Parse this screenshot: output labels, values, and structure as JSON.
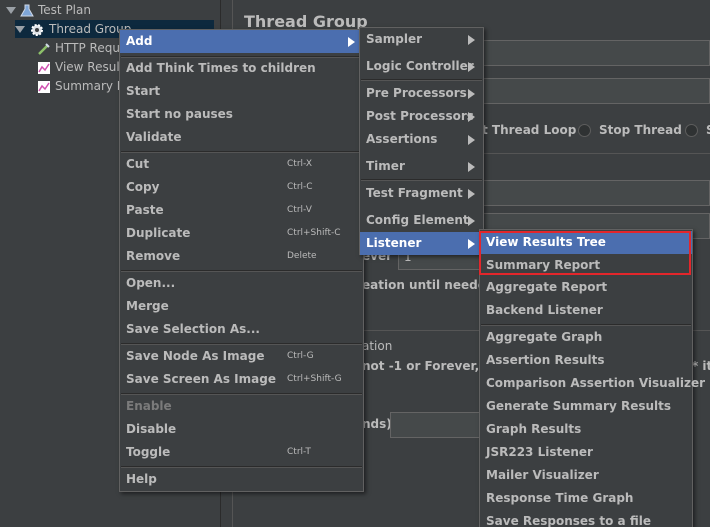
{
  "tree": {
    "items": [
      {
        "label": "Test Plan"
      },
      {
        "label": "Thread Group"
      },
      {
        "label": "HTTP Requ"
      },
      {
        "label": "View Resul"
      },
      {
        "label": "Summary R"
      }
    ]
  },
  "main": {
    "title": "Thread Group",
    "bg_texts": {
      "thread_loop": "t Thread Loop",
      "stop_thread": "Stop Thread",
      "s": "S",
      "ever": "ever",
      "one": "1",
      "creation": "eation until needed",
      "ation": "ation",
      "not_forever": "not -1 or Forever, dura",
      "t_ite": "t * ite",
      "nds": "nds)"
    }
  },
  "context_menu": {
    "items": [
      {
        "label": "Add"
      },
      {
        "label": "Add Think Times to children"
      },
      {
        "label": "Start"
      },
      {
        "label": "Start no pauses"
      },
      {
        "label": "Validate"
      },
      {
        "label": "Cut",
        "shortcut": "Ctrl-X"
      },
      {
        "label": "Copy",
        "shortcut": "Ctrl-C"
      },
      {
        "label": "Paste",
        "shortcut": "Ctrl-V"
      },
      {
        "label": "Duplicate",
        "shortcut": "Ctrl+Shift-C"
      },
      {
        "label": "Remove",
        "shortcut": "Delete"
      },
      {
        "label": "Open..."
      },
      {
        "label": "Merge"
      },
      {
        "label": "Save Selection As..."
      },
      {
        "label": "Save Node As Image",
        "shortcut": "Ctrl-G"
      },
      {
        "label": "Save Screen As Image",
        "shortcut": "Ctrl+Shift-G"
      },
      {
        "label": "Enable"
      },
      {
        "label": "Disable"
      },
      {
        "label": "Toggle",
        "shortcut": "Ctrl-T"
      },
      {
        "label": "Help"
      }
    ]
  },
  "add_menu": {
    "items": [
      {
        "label": "Sampler"
      },
      {
        "label": "Logic Controller"
      },
      {
        "label": "Pre Processors"
      },
      {
        "label": "Post Processors"
      },
      {
        "label": "Assertions"
      },
      {
        "label": "Timer"
      },
      {
        "label": "Test Fragment"
      },
      {
        "label": "Config Element"
      },
      {
        "label": "Listener"
      }
    ]
  },
  "listener_menu": {
    "items": [
      {
        "label": "View Results Tree"
      },
      {
        "label": "Summary Report"
      },
      {
        "label": "Aggregate Report"
      },
      {
        "label": "Backend Listener"
      },
      {
        "label": "Aggregate Graph"
      },
      {
        "label": "Assertion Results"
      },
      {
        "label": "Comparison Assertion Visualizer"
      },
      {
        "label": "Generate Summary Results"
      },
      {
        "label": "Graph Results"
      },
      {
        "label": "JSR223 Listener"
      },
      {
        "label": "Mailer Visualizer"
      },
      {
        "label": "Response Time Graph"
      },
      {
        "label": "Save Responses to a file"
      }
    ]
  },
  "colors": {
    "menu_highlight": "#4b6eaf",
    "annotation_box": "#e3262b",
    "background": "#3c3f41"
  }
}
